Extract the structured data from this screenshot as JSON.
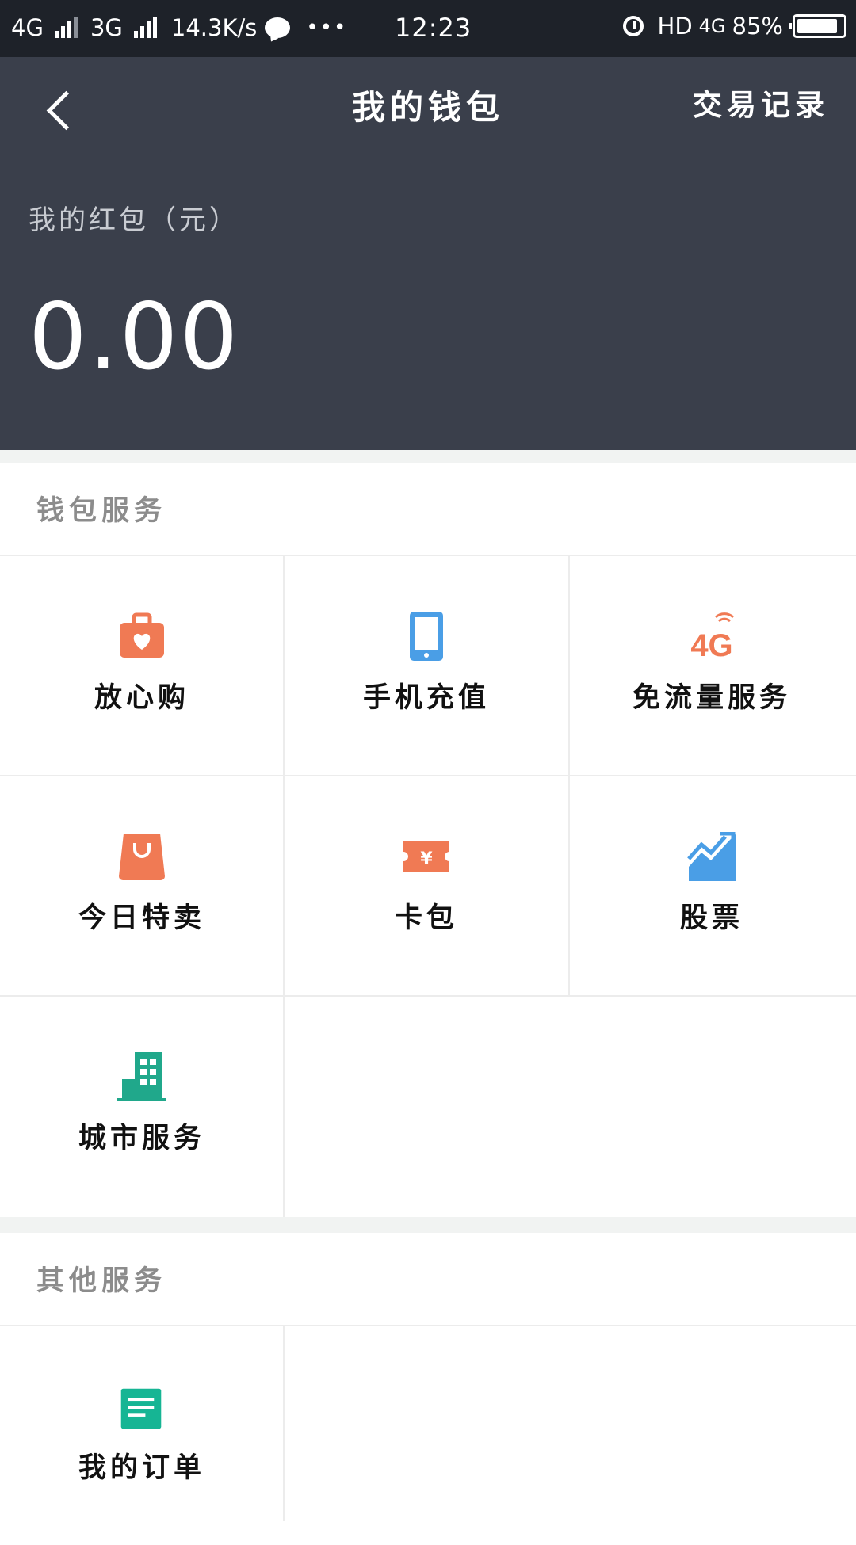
{
  "status_bar": {
    "network1": "4G",
    "network2": "3G",
    "speed": "14.3K/s",
    "more": "•••",
    "time": "12:23",
    "hd": "HD",
    "network3": "4G",
    "battery": "85%"
  },
  "header": {
    "title": "我的钱包",
    "records_label": "交易记录",
    "balance_label": "我的红包（元）",
    "balance_value": "0.00"
  },
  "wallet_services": {
    "title": "钱包服务",
    "items": [
      {
        "label": "放心购",
        "icon": "shopping-bag-heart-icon",
        "color": "#f07a54"
      },
      {
        "label": "手机充值",
        "icon": "phone-icon",
        "color": "#4a9ee6"
      },
      {
        "label": "免流量服务",
        "icon": "4g-icon",
        "color": "#f07a54"
      },
      {
        "label": "今日特卖",
        "icon": "shopping-bag-icon",
        "color": "#f07a54"
      },
      {
        "label": "卡包",
        "icon": "ticket-yuan-icon",
        "color": "#f07a54"
      },
      {
        "label": "股票",
        "icon": "stock-chart-icon",
        "color": "#4a9ee6"
      },
      {
        "label": "城市服务",
        "icon": "city-building-icon",
        "color": "#20a88b"
      }
    ]
  },
  "other_services": {
    "title": "其他服务",
    "items": [
      {
        "label": "我的订单",
        "icon": "order-document-icon",
        "color": "#16b594"
      }
    ]
  }
}
